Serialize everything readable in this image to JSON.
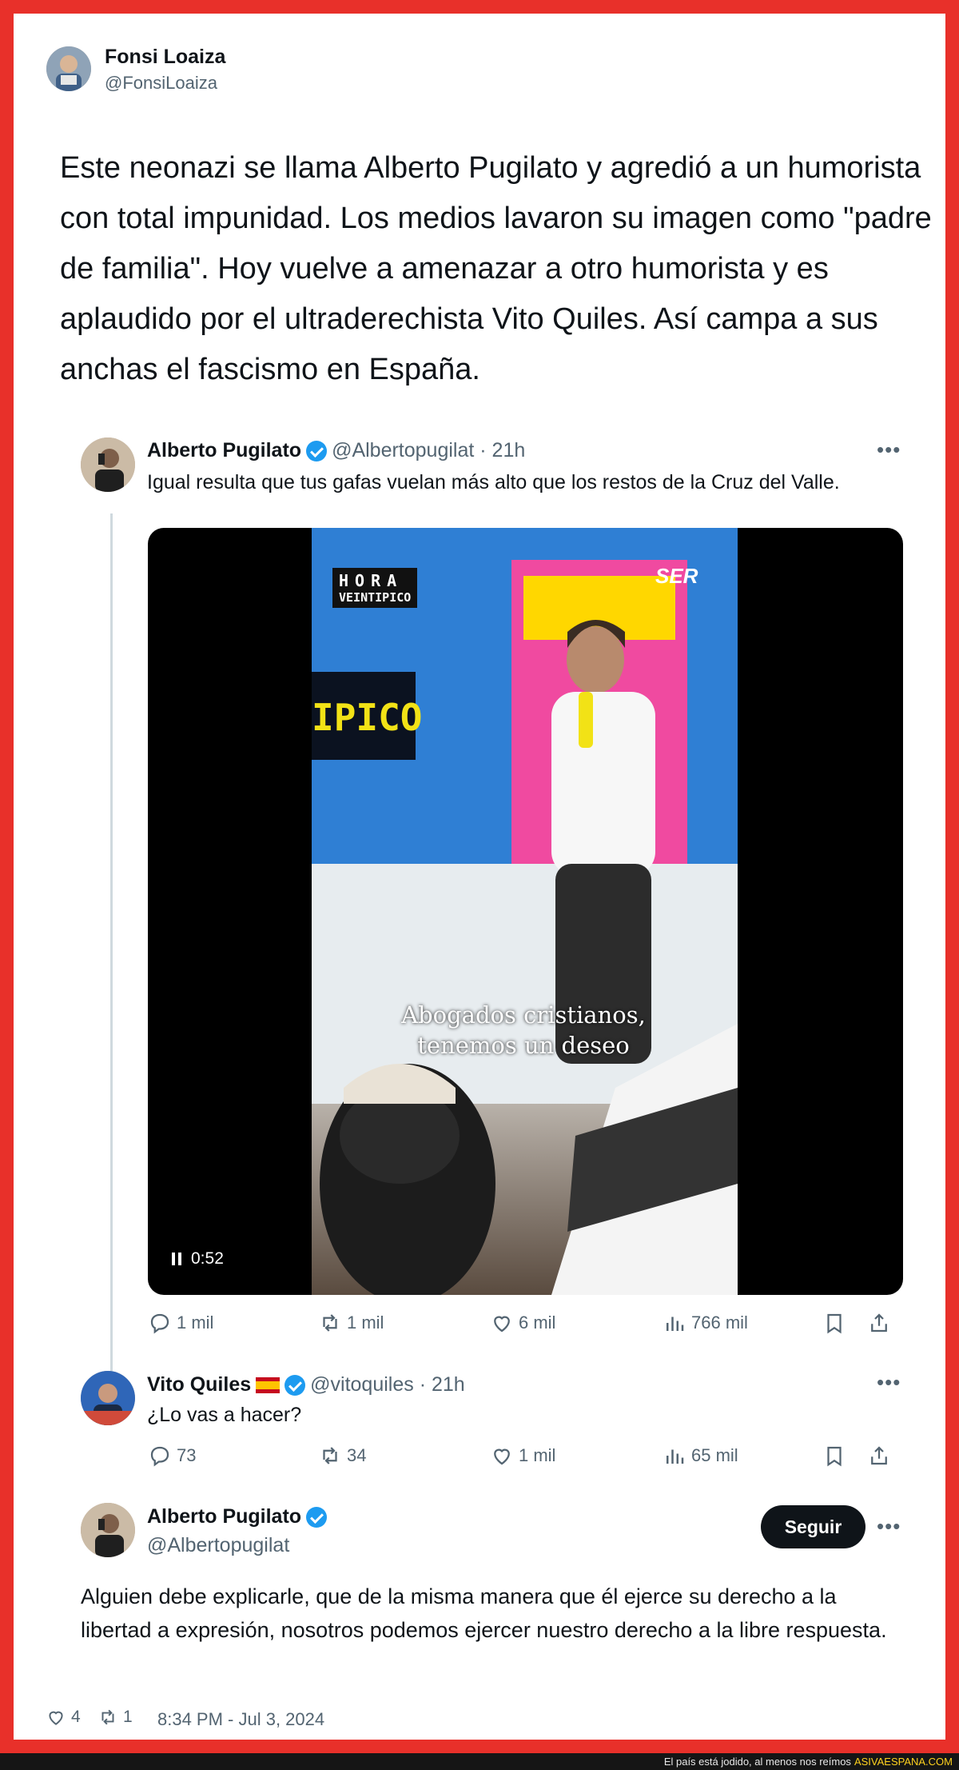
{
  "post": {
    "author_name": "Fonsi Loaiza",
    "author_handle": "@FonsiLoaiza",
    "text": "Este neonazi se llama Alberto Pugilato y agredió a un humorista con total impunidad. Los medios lavaron su imagen como \"padre de familia\". Hoy vuelve a amenazar a otro humorista y es aplaudido por el ultraderechista Vito Quiles. Así campa a sus anchas el fascismo en España.",
    "likes": "4",
    "reposts": "1",
    "timestamp": "8:34 PM - Jul 3, 2024"
  },
  "embedded": {
    "tweet1": {
      "name": "Alberto Pugilato",
      "meta": "@Albertopugilat · 21h",
      "text": "Igual resulta que tus gafas vuelan más alto que los restos de la Cruz del Valle.",
      "video": {
        "logo_top": "HORA",
        "logo_bottom": "VEINTIPICO",
        "network": "SER",
        "wall_text": "IPICO",
        "subtitle_line1": "Abogados cristianos,",
        "subtitle_line2": "tenemos un deseo",
        "time": "0:52"
      },
      "replies": "1 mil",
      "reposts": "1 mil",
      "likes": "6 mil",
      "views": "766 mil"
    },
    "tweet2": {
      "name": "Vito Quiles",
      "flag": "🇪🇸",
      "meta": "@vitoquiles · 21h",
      "text": "¿Lo vas a hacer?",
      "replies": "73",
      "reposts": "34",
      "likes": "1 mil",
      "views": "65 mil"
    },
    "tweet3": {
      "name": "Alberto Pugilato",
      "handle": "@Albertopugilat",
      "follow_label": "Seguir",
      "text": "Alguien debe explicarle, que de la misma manera que él ejerce su derecho a la libertad a expresión, nosotros podemos ejercer nuestro derecho a la libre respuesta."
    }
  },
  "footer": {
    "tagline": "El país está jodido, al menos nos reímos",
    "site": "ASIVAESPANA.COM"
  },
  "colors": {
    "frame": "#e8302a",
    "verified": "#1d9bf0",
    "footer_site": "#ffd21e"
  }
}
